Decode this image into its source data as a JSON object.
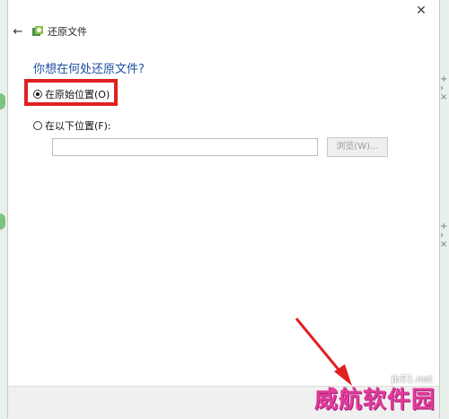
{
  "window": {
    "close_glyph": "✕",
    "back_glyph": "←",
    "title": "还原文件"
  },
  "main": {
    "heading": "你想在何处还原文件?",
    "option_original": "在原始位置(O)",
    "option_other": "在以下位置(F):",
    "path_value": "",
    "browse_label": "浏览(W)..."
  },
  "watermark": {
    "site": "jb51.net",
    "text": "威航软件园"
  },
  "colors": {
    "heading": "#1e4fa0",
    "highlight_box": "#e02020",
    "watermark": "#e23a9a"
  }
}
